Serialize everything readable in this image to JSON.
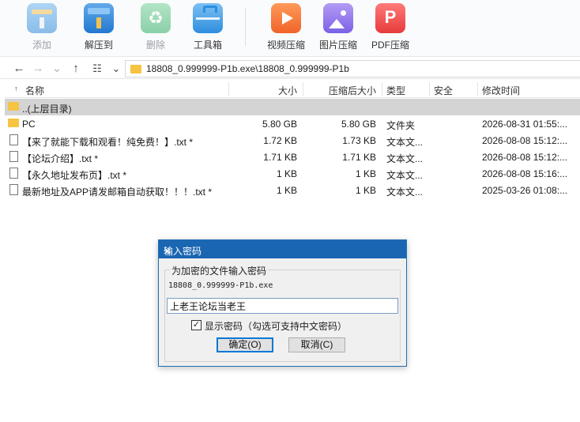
{
  "toolbar": {
    "items": [
      {
        "label": "添加",
        "icon": "add-archive-icon",
        "disabled": true
      },
      {
        "label": "解压到",
        "icon": "extract-icon",
        "disabled": false
      },
      {
        "label": "删除",
        "icon": "recycle-icon",
        "disabled": true
      },
      {
        "label": "工具箱",
        "icon": "toolbox-icon",
        "disabled": false
      },
      {
        "label": "视频压缩",
        "icon": "video-compress-icon",
        "disabled": false
      },
      {
        "label": "图片压缩",
        "icon": "image-compress-icon",
        "disabled": false
      },
      {
        "label": "PDF压缩",
        "icon": "pdf-compress-icon",
        "disabled": false
      }
    ]
  },
  "address": {
    "path": "18808_0.999999-P1b.exe\\18808_0.999999-P1b"
  },
  "columns": {
    "name": "名称",
    "size": "大小",
    "compressed": "压缩后大小",
    "type": "类型",
    "security": "安全",
    "modified": "修改时间"
  },
  "files": [
    {
      "name": "..(上层目录)",
      "size": "",
      "compressed": "",
      "type": "",
      "security": "",
      "modified": "",
      "icon": "parent-folder-icon"
    },
    {
      "name": "PC",
      "size": "5.80 GB",
      "compressed": "5.80 GB",
      "type": "文件夹",
      "security": "",
      "modified": "2026-08-31 01:55:...",
      "icon": "folder-icon"
    },
    {
      "name": "【来了就能下载和观看！纯免费！】.txt *",
      "size": "1.72 KB",
      "compressed": "1.73 KB",
      "type": "文本文...",
      "security": "",
      "modified": "2026-08-08 15:12:...",
      "icon": "text-file-icon"
    },
    {
      "name": "【论坛介绍】.txt *",
      "size": "1.71 KB",
      "compressed": "1.71 KB",
      "type": "文本文...",
      "security": "",
      "modified": "2026-08-08 15:12:...",
      "icon": "text-file-icon"
    },
    {
      "name": "【永久地址发布页】.txt *",
      "size": "1 KB",
      "compressed": "1 KB",
      "type": "文本文...",
      "security": "",
      "modified": "2026-08-08 15:16:...",
      "icon": "text-file-icon"
    },
    {
      "name": "最新地址及APP请发邮箱自动获取！！！.txt *",
      "size": "1 KB",
      "compressed": "1 KB",
      "type": "文本文...",
      "security": "",
      "modified": "2025-03-26 01:08:...",
      "icon": "text-file-icon"
    }
  ],
  "dialog": {
    "title": "输入密码",
    "group_label": "为加密的文件输入密码",
    "filename": "18808_0.999999-P1b.exe",
    "password_value": "上老王论坛当老王",
    "show_password_checked": true,
    "show_password_label": "显示密码（勾选可支持中文密码）",
    "ok_label": "确定(O)",
    "cancel_label": "取消(C)"
  },
  "colors": {
    "dialog_title_bg": "#1a66b3",
    "selected_row_bg": "#d4d4d4",
    "folder_yellow": "#f6c343"
  }
}
